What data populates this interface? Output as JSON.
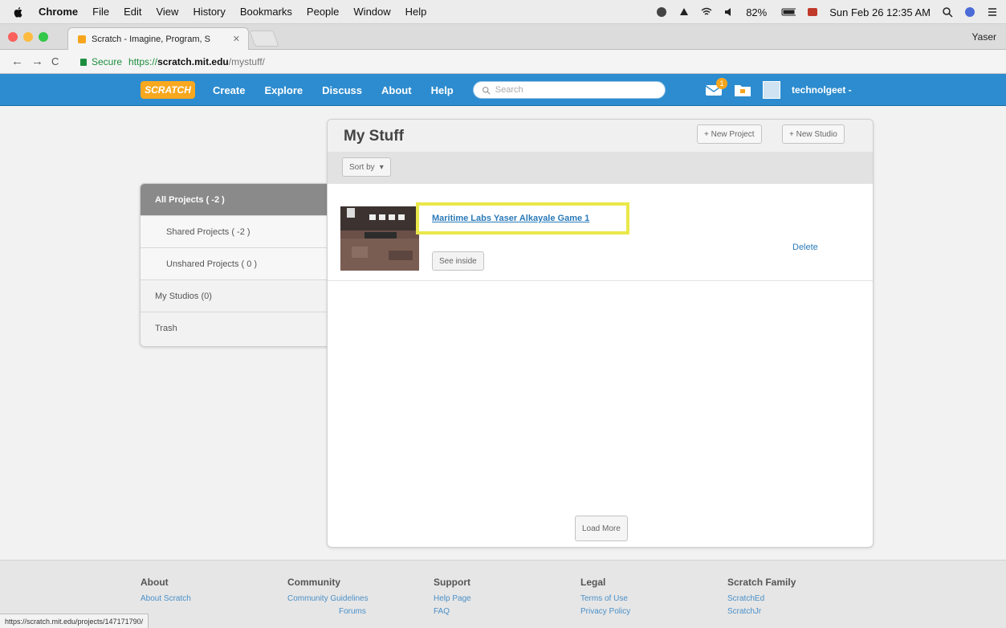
{
  "menubar": {
    "app": "Chrome",
    "items": [
      "File",
      "Edit",
      "View",
      "History",
      "Bookmarks",
      "People",
      "Window",
      "Help"
    ],
    "battery": "82%",
    "datetime": "Sun Feb 26  12:35 AM"
  },
  "browser": {
    "tab_title": "Scratch - Imagine, Program, S",
    "profile": "Yaser",
    "secure_label": "Secure",
    "url_scheme": "https://",
    "url_host": "scratch.mit.edu",
    "url_path": "/mystuff/"
  },
  "scratch_nav": {
    "logo": "SCRATCH",
    "links": [
      "Create",
      "Explore",
      "Discuss",
      "About",
      "Help"
    ],
    "search_placeholder": "Search",
    "message_count": "1",
    "username": "technolgeet -"
  },
  "sidebar": {
    "items": [
      {
        "label": "All Projects ( -2 )"
      },
      {
        "label": "Shared Projects ( -2 )"
      },
      {
        "label": "Unshared Projects ( 0 )"
      },
      {
        "label": "My Studios (0)"
      },
      {
        "label": "Trash"
      }
    ]
  },
  "main": {
    "title": "My Stuff",
    "new_project": "+ New Project",
    "new_studio": "+ New Studio",
    "sort_by": "Sort by",
    "project": {
      "title": "Maritime Labs Yaser Alkayale Game 1",
      "see_inside": "See inside",
      "delete": "Delete"
    },
    "load_more": "Load More"
  },
  "footer": {
    "columns": [
      {
        "heading": "About",
        "links": [
          "About Scratch"
        ]
      },
      {
        "heading": "Community",
        "links": [
          "Community Guidelines",
          "Forums"
        ]
      },
      {
        "heading": "Support",
        "links": [
          "Help Page",
          "FAQ"
        ]
      },
      {
        "heading": "Legal",
        "links": [
          "Terms of Use",
          "Privacy Policy"
        ]
      },
      {
        "heading": "Scratch Family",
        "links": [
          "ScratchEd",
          "ScratchJr"
        ]
      }
    ]
  },
  "statusbar": {
    "url": "https://scratch.mit.edu/projects/147171790/"
  },
  "colors": {
    "scratch_blue": "#2d8ccf",
    "highlight_yellow": "#e9e84a",
    "link_blue": "#2a7ab8"
  }
}
